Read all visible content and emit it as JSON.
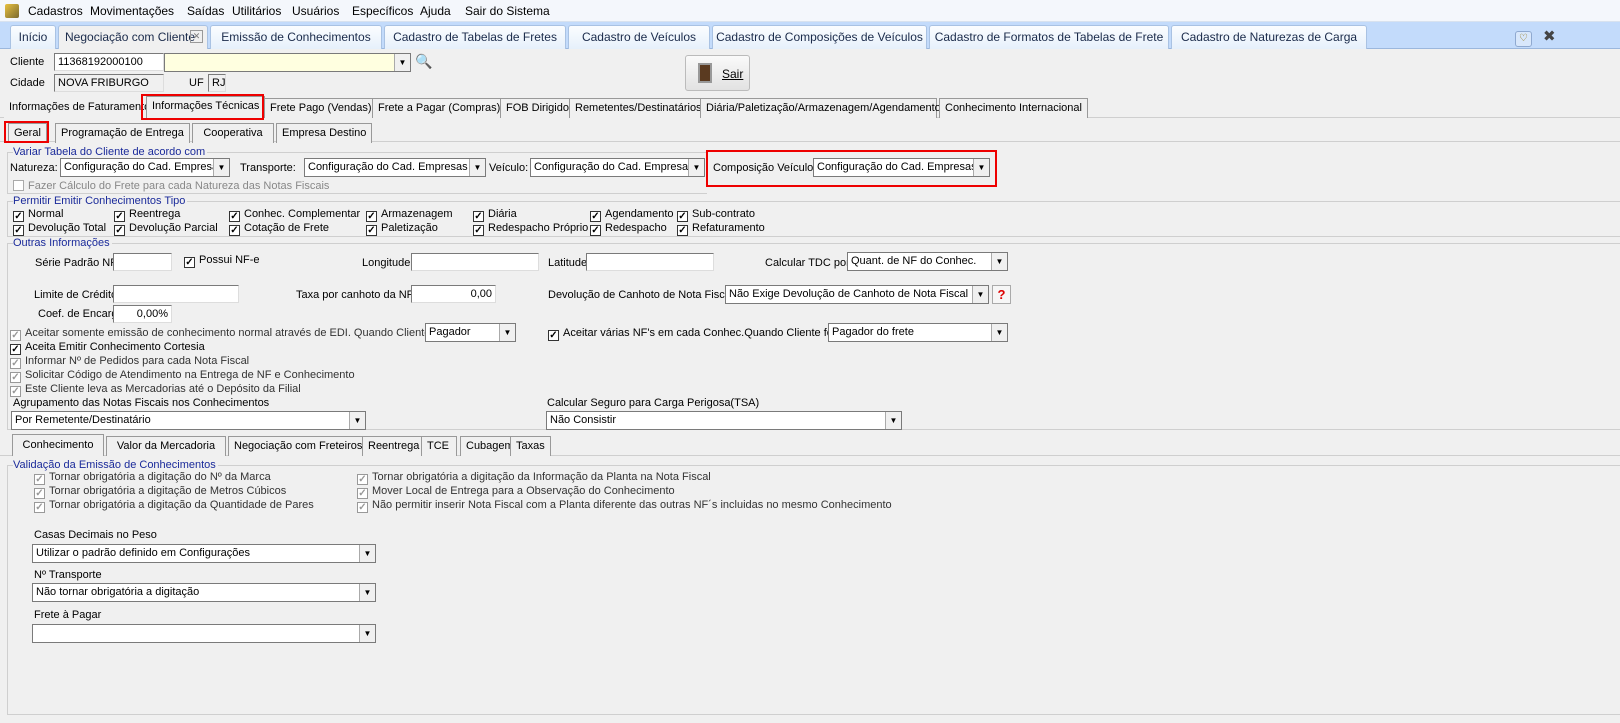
{
  "menu": [
    "Cadastros",
    "Movimentações",
    "Saídas",
    "Utilitários",
    "Usuários",
    "Específicos",
    "Ajuda",
    "Sair do Sistema"
  ],
  "window_tabs": [
    "Início",
    "Negociação com Cliente",
    "Emissão de Conhecimentos",
    "Cadastro de Tabelas de Fretes",
    "Cadastro de Veículos",
    "Cadastro de Composições de Veículos",
    "Cadastro de Formatos de Tabelas de Frete",
    "Cadastro de Naturezas de Carga"
  ],
  "header": {
    "cliente_label": "Cliente",
    "cliente_value": "11368192000100",
    "cliente_name": "",
    "cidade_label": "Cidade",
    "cidade_value": "NOVA FRIBURGO",
    "uf_label": "UF",
    "uf_value": "RJ",
    "sair_label": "Sair"
  },
  "main_tabs": [
    "Informações de Faturamento",
    "Informações Técnicas",
    "Frete Pago (Vendas)",
    "Frete a Pagar (Compras)",
    "FOB Dirigido",
    "Remetentes/Destinatários",
    "Diária/Paletização/Armazenagem/Agendamento",
    "Conhecimento Internacional"
  ],
  "sub_tabs": [
    "Geral",
    "Programação de Entrega",
    "Cooperativa",
    "Empresa Destino"
  ],
  "variar": {
    "title": "Variar Tabela do Cliente de acordo com",
    "natureza_label": "Natureza:",
    "natureza": "Configuração do Cad. Empresas",
    "transporte_label": "Transporte:",
    "transporte": "Configuração do Cad. Empresas",
    "veiculo_label": "Veículo:",
    "veiculo": "Configuração do Cad. Empresas",
    "composicao_label": "Composição Veículo",
    "composicao": "Configuração do Cad. Empresas",
    "fazer_calculo": "Fazer Cálculo do Frete para cada Natureza das Notas Fiscais"
  },
  "permitir": {
    "title": "Permitir Emitir Conhecimentos Tipo",
    "items": [
      "Normal",
      "Reentrega",
      "Conhec. Complementar",
      "Armazenagem",
      "Diária",
      "Agendamento",
      "Sub-contrato",
      "Devolução Total",
      "Devolução Parcial",
      "Cotação de Frete",
      "Paletização",
      "Redespacho Próprio",
      "Redespacho",
      "Refaturamento"
    ]
  },
  "outras": {
    "title": "Outras Informações",
    "serie_label": "Série Padrão NF",
    "serie": "",
    "possui_nfe": "Possui NF-e",
    "longitude_label": "Longitude",
    "longitude": "",
    "latitude_label": "Latitude",
    "latitude": "",
    "tdc_label": "Calcular TDC por",
    "tdc": "Quant. de NF do Conhec.",
    "limite_label": "Limite de Crédito",
    "limite": "",
    "taxa_label": "Taxa por canhoto da NF",
    "taxa": "0,00",
    "devolucao_label": "Devolução de Canhoto de Nota Fiscal",
    "devolucao": "Não Exige Devolução de Canhoto de Nota Fiscal",
    "help": "?",
    "coef_label": "Coef. de Encargos",
    "coef": "0,00%",
    "edi_label": "Aceitar somente emissão de conhecimento normal através de EDI. Quando Cliente for",
    "edi": "Pagador",
    "varias_label": "Aceitar várias NF's em cada Conhec.Quando Cliente for",
    "varias": "Pagador do frete",
    "cortesia": "Aceita Emitir Conhecimento Cortesia",
    "pedidos": "Informar Nº de Pedidos para cada Nota Fiscal",
    "codigo": "Solicitar Código de Atendimento na Entrega de NF e Conhecimento",
    "deposito": "Este Cliente leva as Mercadorias até o Depósito da Filial",
    "agrup_label": "Agrupamento das Notas Fiscais nos Conhecimentos",
    "agrup": "Por Remetente/Destinatário",
    "seguro_label": "Calcular Seguro para Carga Perigosa(TSA)",
    "seguro": "Não Consistir"
  },
  "bottom_tabs": [
    "Conhecimento",
    "Valor da Mercadoria",
    "Negociação com Freteiros",
    "Reentrega",
    "TCE",
    "Cubagem",
    "Taxas"
  ],
  "validacao": {
    "title": "Validação da Emissão de Conhecimentos",
    "left": [
      "Tornar obrigatória a digitação do Nº da Marca",
      "Tornar obrigatória a digitação de Metros Cúbicos",
      "Tornar obrigatória a digitação da Quantidade de Pares"
    ],
    "right": [
      "Tornar obrigatória a digitação da Informação da Planta na Nota Fiscal",
      "Mover Local de Entrega para a Observação do Conhecimento",
      "Não permitir inserir Nota Fiscal com a Planta diferente das outras NF´s  incluidas no mesmo Conhecimento"
    ],
    "casas_label": "Casas Decimais no Peso",
    "casas": "Utilizar o padrão definido em Configurações",
    "transporte_label": "Nº Transporte",
    "transporte": "Não tornar obrigatória a digitação",
    "frete_label": "Frete à Pagar",
    "frete": ""
  }
}
